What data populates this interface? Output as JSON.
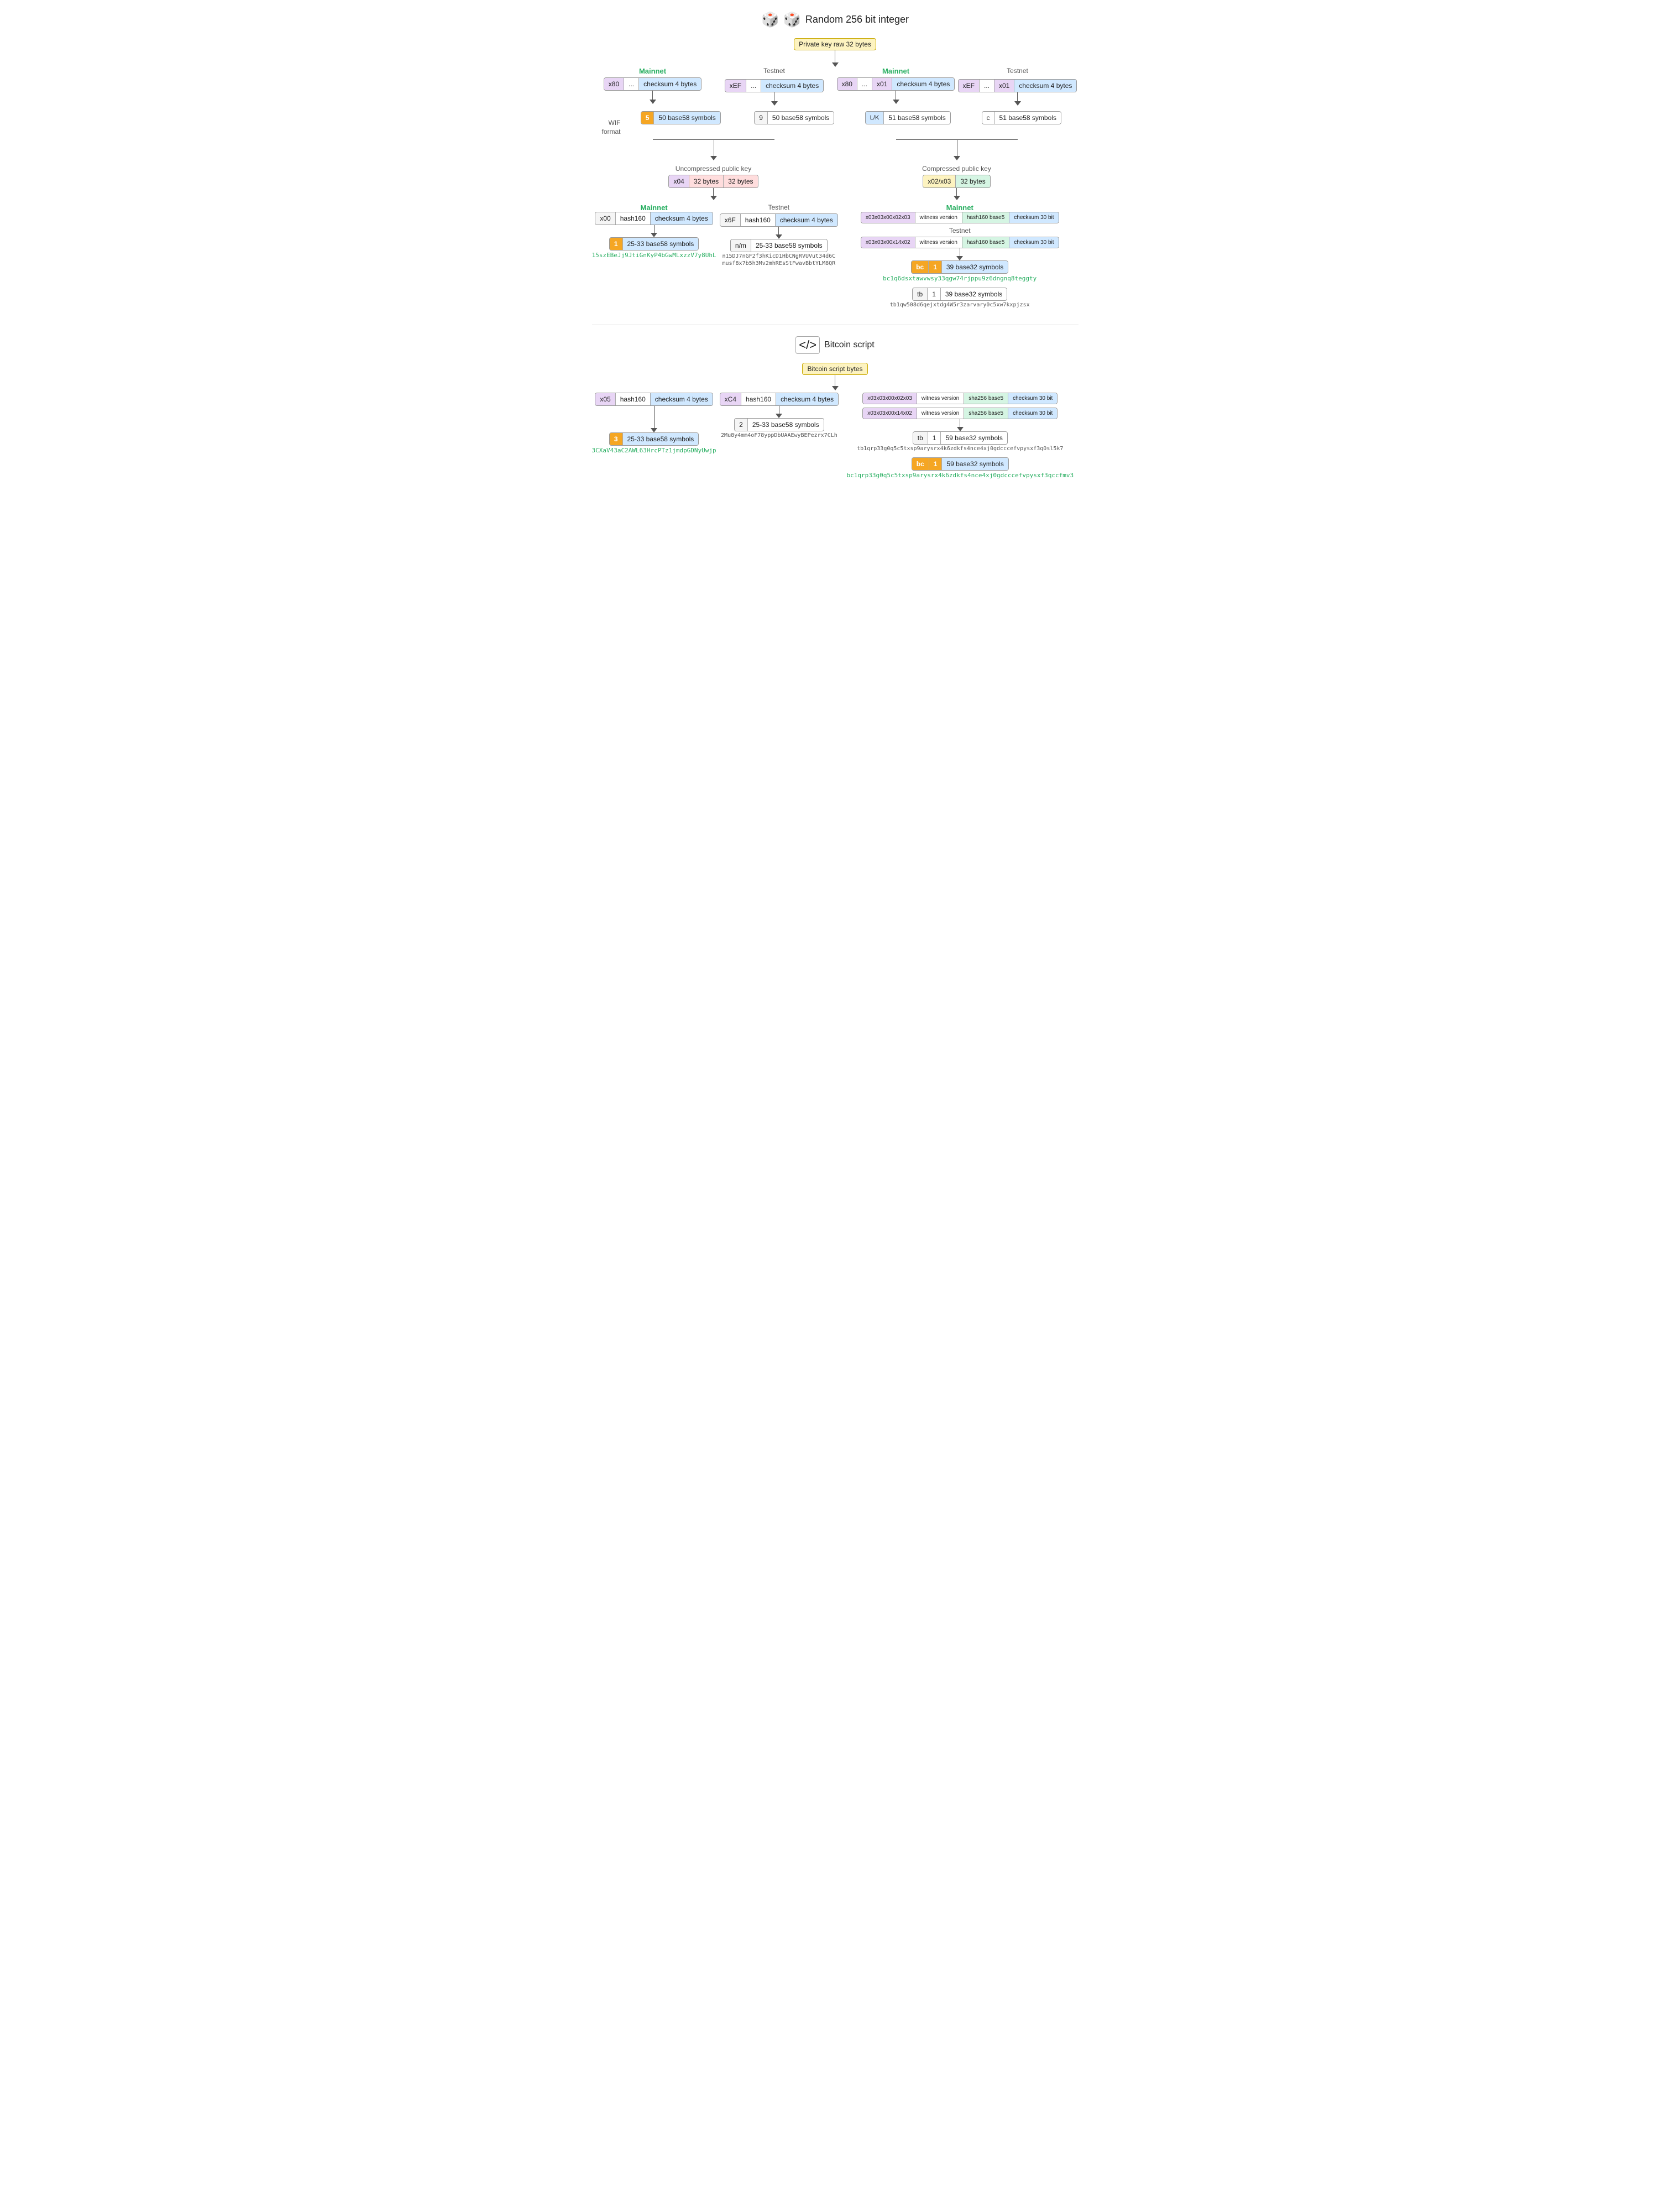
{
  "header": {
    "title": "Random 256 bit integer",
    "dice_icon": "🎲"
  },
  "top": {
    "private_key_box": "Private key raw 32 bytes",
    "mainnet1": "Mainnet",
    "testnet1": "Testnet",
    "mainnet2": "Mainnet",
    "testnet2": "Testnet",
    "col1_prefix": "x80",
    "col1_dots": "...",
    "col1_checksum": "checksum 4 bytes",
    "col2_prefix": "xEF",
    "col2_dots": "...",
    "col2_checksum": "checksum 4 bytes",
    "col3_prefix": "x80",
    "col3_dots": "...",
    "col3_01": "x01",
    "col3_checksum": "checksum 4 bytes",
    "col4_prefix": "xEF",
    "col4_dots": "...",
    "col4_01": "x01",
    "col4_checksum": "checksum 4 bytes"
  },
  "wif": {
    "label_line1": "WIF",
    "label_line2": "format",
    "col1_prefix": "5",
    "col1_body": "50 base58 symbols",
    "col2_prefix": "9",
    "col2_body": "50 base58 symbols",
    "col3_prefix": "L/K",
    "col3_body": "51 base58 symbols",
    "col4_prefix": "c",
    "col4_body": "51 base58 symbols"
  },
  "pubkey": {
    "uncompressed_title": "Uncompressed public key",
    "compressed_title": "Compressed public key",
    "uncompressed_prefix": "x04",
    "uncompressed_b1": "32 bytes",
    "uncompressed_b2": "32 bytes",
    "compressed_prefix": "x02/x03",
    "compressed_body": "32 bytes"
  },
  "addr": {
    "mainnet_p2pkh_label": "Mainnet",
    "testnet_p2pkh_label": "Testnet",
    "mainnet_p2pkh_prefix": "x00",
    "mainnet_p2pkh_hash": "hash160",
    "mainnet_p2pkh_checksum": "checksum 4 bytes",
    "testnet_p2pkh_prefix": "x6F",
    "testnet_p2pkh_hash": "hash160",
    "testnet_p2pkh_checksum": "checksum 4 bytes",
    "mainnet_p2wpkh_label": "Mainnet",
    "mainnet_p2wpkh_prefix": "x03x03x00x02x03",
    "mainnet_p2wpkh_witness": "witness version",
    "mainnet_p2wpkh_hash": "hash160 base5",
    "mainnet_p2wpkh_checksum": "checksum 30 bit",
    "testnet_p2wpkh_prefix": "x03x03x00x14x02",
    "testnet_p2wpkh_witness": "witness version",
    "testnet_p2wpkh_hash": "hash160 base5",
    "testnet_p2wpkh_checksum": "checksum 30 bit",
    "p2pkh_mainnet_num": "1",
    "p2pkh_mainnet_body": "25-33 base58 symbols",
    "p2pkh_testnet_prefix": "n/m",
    "p2pkh_testnet_body": "25-33 base58 symbols",
    "p2wpkh_mainnet_bc": "bc",
    "p2wpkh_mainnet_1": "1",
    "p2wpkh_mainnet_body": "39 base32 symbols",
    "p2wpkh_testnet_tb": "tb",
    "p2wpkh_testnet_1": "1",
    "p2wpkh_testnet_body": "39 base32 symbols",
    "sample_p2pkh_mainnet": "15szEBeJj9JtiGnKyP4bGwMLxzzV7y8UhL",
    "sample_p2pkh_testnet_1": "n15DJ7nGF2f3hKicD1HbCNgRVUVut34d6C",
    "sample_p2pkh_testnet_2": "musf8x7b5h3Mv2mhREsStFwavBbtYLM8QR",
    "sample_p2wpkh_mainnet": "bc1q6dsxtawvwsy33qgw74rjppu9z6dngnq8teggty",
    "sample_p2wpkh_testnet": "tb1qw508d6qejxtdg4W5r3zarvary0c5xw7kxpjzsx"
  },
  "script": {
    "title": "Bitcoin script",
    "bytes_box": "Bitcoin script bytes",
    "col1_prefix": "x05",
    "col1_hash": "hash160",
    "col1_checksum": "checksum 4 bytes",
    "col2_prefix": "xC4",
    "col2_hash": "hash160",
    "col2_checksum": "checksum 4 bytes",
    "col3_mainnet_prefix": "x03x03x00x02x03",
    "col3_mainnet_witness": "witness version",
    "col3_mainnet_sha": "sha256 base5",
    "col3_mainnet_checksum": "checksum 30 bit",
    "col3_testnet_prefix": "x03x03x00x14x02",
    "col3_testnet_witness": "witness version",
    "col3_testnet_sha": "sha256 base5",
    "col3_testnet_checksum": "checksum 30 bit",
    "col1_addr_num": "3",
    "col1_addr_body": "25-33 base58 symbols",
    "col2_addr_num": "2",
    "col2_addr_body": "25-33 base58 symbols",
    "col3_mainnet_bc": "bc",
    "col3_mainnet_1": "1",
    "col3_mainnet_body": "59 base32 symbols",
    "col3_testnet_tb": "tb",
    "col3_testnet_1": "1",
    "col3_testnet_body": "59 base32 symbols",
    "sample_col1": "3CXaV43aC2AWL63HrcPTz1jmdpGDNyUwjp",
    "sample_col2": "2Mu8y4mm4oF78yppDbUAAEwyBEPezrx7CLh",
    "sample_col3_mainnet": "bc1qrp33g0q5c5txsp9arysrx4k6zdkfs4nce4xj0gdcccefvpysxf3qccfmv3",
    "sample_col3_testnet": "tb1qrp33g0q5c5txsp9arysrx4k6zdkfs4nce4xj0gdcccefvpysxf3q0sl5k7"
  }
}
